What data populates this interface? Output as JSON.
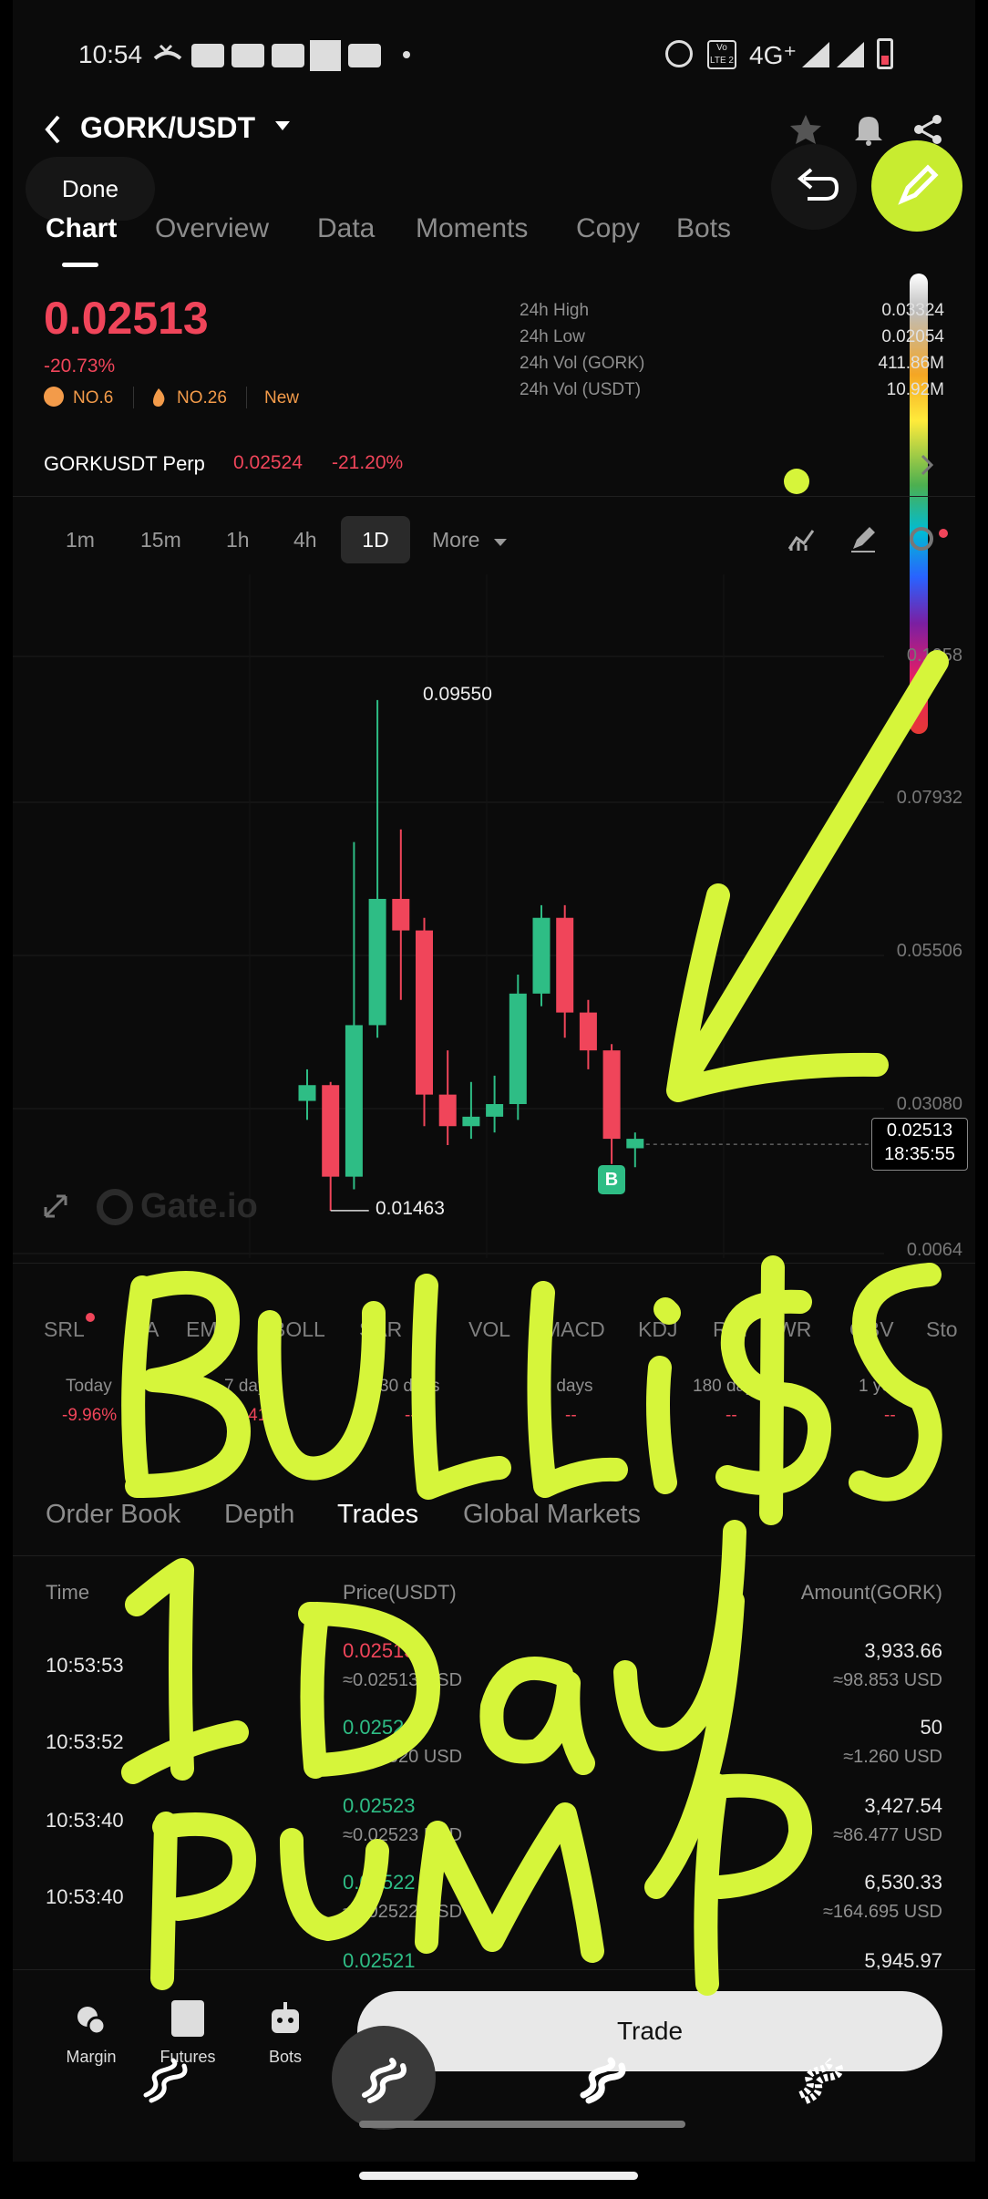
{
  "status_bar": {
    "time": "10:54",
    "network": "4G⁺",
    "volte": "Vo LTE 2"
  },
  "header": {
    "pair": "GORK/USDT",
    "done_label": "Done"
  },
  "tabs": [
    "Chart",
    "Overview",
    "Data",
    "Moments",
    "Copy",
    "Bots"
  ],
  "price": {
    "last": "0.02513",
    "change": "-20.73%",
    "badge_rank": "NO.6",
    "badge_hot": "NO.26",
    "badge_new": "New"
  },
  "stats": {
    "high_label": "24h High",
    "high_value": "0.03324",
    "low_label": "24h Low",
    "low_value": "0.02054",
    "vol_gork_label": "24h Vol (GORK)",
    "vol_gork_value": "411.86M",
    "vol_usdt_label": "24h Vol (USDT)",
    "vol_usdt_value": "10.92M"
  },
  "perp": {
    "name": "GORKUSDT Perp",
    "price": "0.02524",
    "change": "-21.20%"
  },
  "timeframes": [
    "1m",
    "15m",
    "1h",
    "4h",
    "1D",
    "More"
  ],
  "chart_data": {
    "type": "candlestick",
    "interval": "1D",
    "y_ticks": [
      "0.1058",
      "0.07932",
      "0.05506",
      "0.03080",
      "0.0064"
    ],
    "high_label": "0.09550",
    "low_label": "0.01463",
    "last_price": "0.02513",
    "last_time": "18:35:55",
    "buy_marker": "B",
    "watermark": "Gate.io",
    "candles": [
      {
        "o": 0.032,
        "h": 0.037,
        "l": 0.029,
        "c": 0.0345
      },
      {
        "o": 0.0345,
        "h": 0.035,
        "l": 0.0146,
        "c": 0.02
      },
      {
        "o": 0.02,
        "h": 0.073,
        "l": 0.018,
        "c": 0.044
      },
      {
        "o": 0.044,
        "h": 0.0955,
        "l": 0.042,
        "c": 0.064
      },
      {
        "o": 0.064,
        "h": 0.075,
        "l": 0.048,
        "c": 0.059
      },
      {
        "o": 0.059,
        "h": 0.061,
        "l": 0.028,
        "c": 0.033
      },
      {
        "o": 0.033,
        "h": 0.04,
        "l": 0.025,
        "c": 0.028
      },
      {
        "o": 0.028,
        "h": 0.035,
        "l": 0.026,
        "c": 0.0295
      },
      {
        "o": 0.0295,
        "h": 0.036,
        "l": 0.027,
        "c": 0.0315
      },
      {
        "o": 0.0315,
        "h": 0.052,
        "l": 0.029,
        "c": 0.049
      },
      {
        "o": 0.049,
        "h": 0.063,
        "l": 0.047,
        "c": 0.061
      },
      {
        "o": 0.061,
        "h": 0.063,
        "l": 0.042,
        "c": 0.046
      },
      {
        "o": 0.046,
        "h": 0.048,
        "l": 0.037,
        "c": 0.04
      },
      {
        "o": 0.04,
        "h": 0.041,
        "l": 0.022,
        "c": 0.026
      },
      {
        "o": 0.0245,
        "h": 0.027,
        "l": 0.0215,
        "c": 0.026
      }
    ]
  },
  "indicators": [
    "SRL",
    "MA",
    "EMA",
    "BOLL",
    "SAR",
    "VOL",
    "MACD",
    "KDJ",
    "RSI",
    "WR",
    "OBV",
    "Sto"
  ],
  "periods": [
    {
      "label": "Today",
      "value": "-9.96%"
    },
    {
      "label": "7 days",
      "value": "-0.41%"
    },
    {
      "label": "30 days",
      "value": "--"
    },
    {
      "label": "90 days",
      "value": "--"
    },
    {
      "label": "180 days",
      "value": "--"
    },
    {
      "label": "1 year",
      "value": "--"
    }
  ],
  "orderbook_tabs": [
    "Order Book",
    "Depth",
    "Trades",
    "Global Markets"
  ],
  "trades_header": {
    "time": "Time",
    "price": "Price(USDT)",
    "amount": "Amount(GORK)"
  },
  "trades": [
    {
      "time": "10:53:53",
      "price": "0.02513",
      "usd": "≈0.02513 USD",
      "amount": "3,933.66",
      "amount_usd": "≈98.853 USD",
      "side": "sell"
    },
    {
      "time": "10:53:52",
      "price": "0.02520",
      "usd": "≈0.02520 USD",
      "amount": "50",
      "amount_usd": "≈1.260 USD",
      "side": "buy"
    },
    {
      "time": "10:53:40",
      "price": "0.02523",
      "usd": "≈0.02523 USD",
      "amount": "3,427.54",
      "amount_usd": "≈86.477 USD",
      "side": "buy"
    },
    {
      "time": "10:53:40",
      "price": "0.02522",
      "usd": "≈0.02522 USD",
      "amount": "6,530.33",
      "amount_usd": "≈164.695 USD",
      "side": "buy"
    },
    {
      "time": "",
      "price": "0.02521",
      "usd": "",
      "amount": "5,945.97",
      "amount_usd": "",
      "side": "buy"
    }
  ],
  "bottom_nav": {
    "margin": "Margin",
    "futures": "Futures",
    "bots": "Bots",
    "trade": "Trade"
  },
  "colors": {
    "up": "#2ebd85",
    "down": "#f0455a",
    "highlighter": "#d6f53a"
  }
}
